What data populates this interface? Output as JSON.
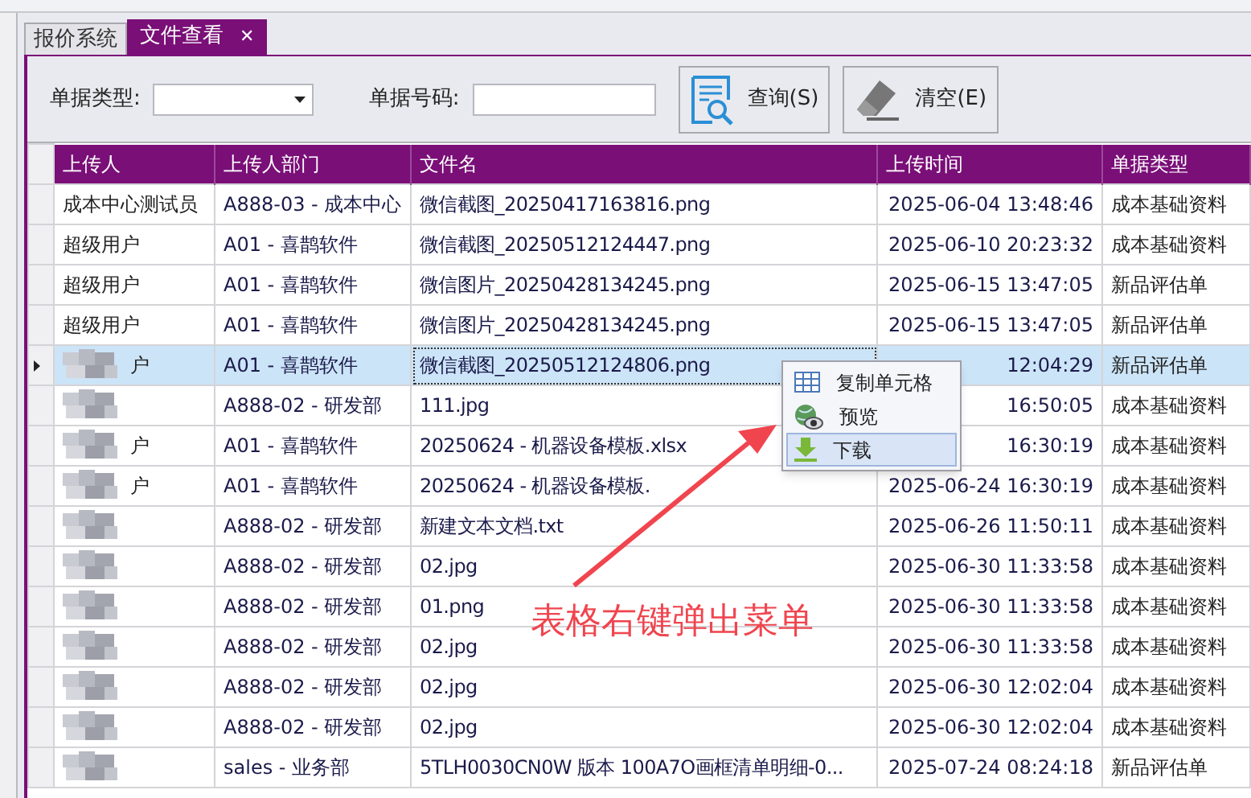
{
  "tabs": [
    {
      "label": "报价系统",
      "selected": false
    },
    {
      "label": "文件查看",
      "selected": true,
      "close": "✕"
    }
  ],
  "filters": [
    {
      "label": "单据类型:",
      "kind": "dropdown"
    },
    {
      "label": "单据号码:",
      "kind": "text"
    }
  ],
  "buttons": [
    {
      "label": "查询(S)",
      "kind": "search"
    },
    {
      "label": "清空(E)",
      "kind": "clear"
    }
  ],
  "table": {
    "columns": [
      "上传人",
      "上传人部门",
      "文件名",
      "上传时间",
      "单据类型"
    ],
    "rows": [
      {
        "uploader": "成本中心测试员",
        "department": "A888-03 - 成本中心",
        "file": "微信截图_20250417163816.png",
        "time": "2025-06-04 13:48:46",
        "type": "成本基础资料",
        "selected": false,
        "redacted": false
      },
      {
        "uploader": "超级用户",
        "department": "A01 - 喜鹊软件",
        "file": "微信截图_20250512124447.png",
        "time": "2025-06-10 20:23:32",
        "type": "成本基础资料",
        "selected": false,
        "redacted": false
      },
      {
        "uploader": "超级用户",
        "department": "A01 - 喜鹊软件",
        "file": "微信图片_20250428134245.png",
        "time": "2025-06-15 13:47:05",
        "type": "新品评估单",
        "selected": false,
        "redacted": false
      },
      {
        "uploader": "超级用户",
        "department": "A01 - 喜鹊软件",
        "file": "微信图片_20250428134245.png",
        "time": "2025-06-15 13:47:05",
        "type": "新品评估单",
        "selected": false,
        "redacted": false
      },
      {
        "uploader": "户",
        "department": "A01 - 喜鹊软件",
        "file": "微信截图_20250512124806.png",
        "time": "12:04:29",
        "type": "新品评估单",
        "selected": true,
        "redacted": true
      },
      {
        "department": "A888-02 - 研发部",
        "file": "111.jpg",
        "time": "16:50:05",
        "type": "成本基础资料",
        "selected": false,
        "redacted": true
      },
      {
        "uploader": "户",
        "department": "A01 - 喜鹊软件",
        "file": "20250624 - 机器设备模板.xlsx",
        "time": "16:30:19",
        "type": "成本基础资料",
        "selected": false,
        "redacted": true
      },
      {
        "uploader": "户",
        "department": "A01 - 喜鹊软件",
        "file": "20250624 - 机器设备模板.",
        "time": "2025-06-24 16:30:19",
        "type": "成本基础资料",
        "selected": false,
        "redacted": true
      },
      {
        "department": "A888-02 - 研发部",
        "file": "新建文本文档.txt",
        "time": "2025-06-26 11:50:11",
        "type": "成本基础资料",
        "selected": false,
        "redacted": true
      },
      {
        "department": "A888-02 - 研发部",
        "file": "02.jpg",
        "time": "2025-06-30 11:33:58",
        "type": "成本基础资料",
        "selected": false,
        "redacted": true
      },
      {
        "department": "A888-02 - 研发部",
        "file": "01.png",
        "time": "2025-06-30 11:33:58",
        "type": "成本基础资料",
        "selected": false,
        "redacted": true
      },
      {
        "department": "A888-02 - 研发部",
        "file": "02.jpg",
        "time": "2025-06-30 11:33:58",
        "type": "成本基础资料",
        "selected": false,
        "redacted": true
      },
      {
        "department": "A888-02 - 研发部",
        "file": "02.jpg",
        "time": "2025-06-30 12:02:04",
        "type": "成本基础资料",
        "selected": false,
        "redacted": true
      },
      {
        "department": "A888-02 - 研发部",
        "file": "02.jpg",
        "time": "2025-06-30 12:02:04",
        "type": "成本基础资料",
        "selected": false,
        "redacted": true
      },
      {
        "department": "sales - 业务部",
        "file": "5TLH0030CN0W 版本 100A7O画框清单明细-0...",
        "time": "2025-07-24 08:24:18",
        "type": "新品评估单",
        "selected": false,
        "redacted": true
      }
    ]
  },
  "context_menu": {
    "items": [
      {
        "label": "复制单元格",
        "kind": "copy",
        "highlighted": false
      },
      {
        "label": "预览",
        "kind": "preview",
        "highlighted": false
      },
      {
        "label": "下载",
        "kind": "download",
        "highlighted": true
      }
    ]
  },
  "annotation": {
    "text": "表格右键弹出菜单"
  }
}
